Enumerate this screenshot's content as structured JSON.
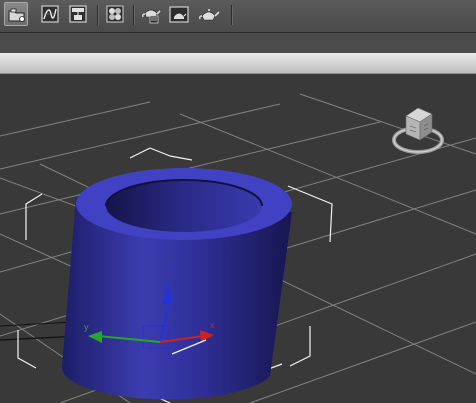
{
  "toolbar": {
    "buttons": [
      {
        "name": "open-explorer-button",
        "icon": "folder-icon"
      },
      {
        "name": "curve-editor-button",
        "icon": "curve-editor-icon"
      },
      {
        "name": "schematic-view-button",
        "icon": "schematic-view-icon"
      },
      {
        "name": "material-editor-button",
        "icon": "material-editor-icon"
      },
      {
        "name": "render-setup-button",
        "icon": "render-setup-teapot-icon"
      },
      {
        "name": "rendered-frame-window-button",
        "icon": "rendered-frame-teapot-icon"
      },
      {
        "name": "render-production-button",
        "icon": "render-teapot-icon"
      }
    ]
  },
  "viewport": {
    "background_color": "#393939",
    "grid_color": "#9a9a9a",
    "object": {
      "type": "tube",
      "color": "#3535a8"
    },
    "gizmo": {
      "x_axis": {
        "label": "x",
        "color": "#cc2222"
      },
      "y_axis": {
        "label": "y",
        "color": "#22aa22"
      },
      "z_axis": {
        "label": "z",
        "color": "#2233dd"
      }
    },
    "viewcube_icon": "viewcube-icon"
  }
}
